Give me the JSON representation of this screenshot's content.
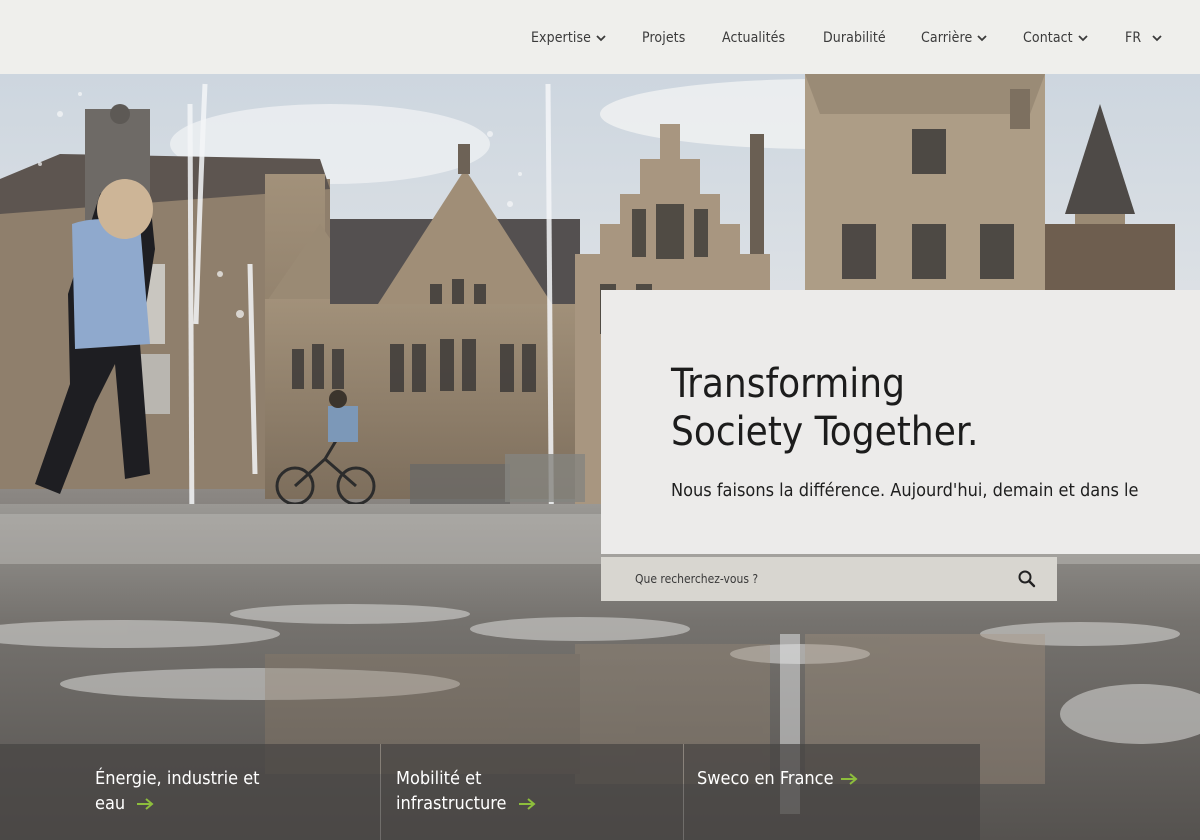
{
  "nav": {
    "items": [
      {
        "label": "Expertise",
        "has_dropdown": true
      },
      {
        "label": "Projets",
        "has_dropdown": false
      },
      {
        "label": "Actualités",
        "has_dropdown": false
      },
      {
        "label": "Durabilité",
        "has_dropdown": false
      },
      {
        "label": "Carrière",
        "has_dropdown": true
      },
      {
        "label": "Contact",
        "has_dropdown": true
      },
      {
        "label": "FR",
        "has_dropdown": true
      }
    ]
  },
  "hero": {
    "title_line1": "Transforming",
    "title_line2": "Society Together.",
    "subtitle": "Nous faisons la différence. Aujourd'hui, demain et dans le"
  },
  "search": {
    "placeholder": "Que recherchez-vous ?",
    "icon": "search-icon"
  },
  "tiles": [
    {
      "label_line1": "Énergie, industrie et",
      "label_line2": "eau"
    },
    {
      "label_line1": "Mobilité et",
      "label_line2": "infrastructure"
    },
    {
      "label_line1": "Sweco en France",
      "label_line2": ""
    }
  ],
  "colors": {
    "accent_green": "#8dbe3c",
    "nav_bg": "#efefec",
    "card_bg": "#ecebea",
    "search_bg": "#d8d6d0",
    "text_dark": "#1c1c1c"
  }
}
